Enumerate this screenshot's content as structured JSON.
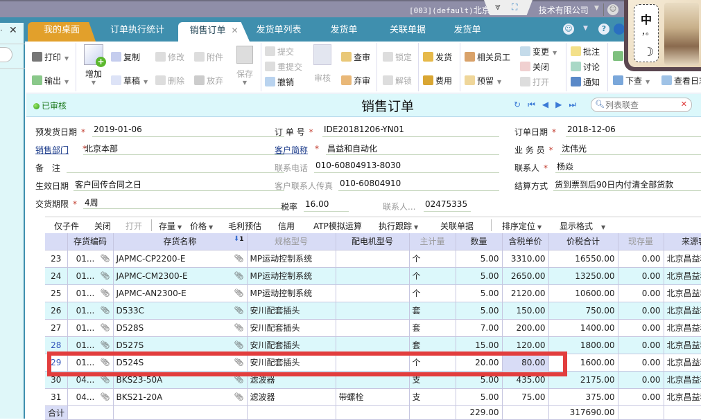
{
  "topbar": {
    "company_prefix": "[003](default)",
    "company_name": "北京昌益和自动化技术有限公司",
    "company_visible_left": "北京",
    "company_visible_right": "技术有限公司"
  },
  "tabs": [
    {
      "label": "我的桌面",
      "state": "home"
    },
    {
      "label": "订单执行统计",
      "state": "normal"
    },
    {
      "label": "销售订单",
      "state": "active",
      "closable": true
    },
    {
      "label": "发货单列表",
      "state": "normal"
    },
    {
      "label": "发货单",
      "state": "normal"
    },
    {
      "label": "关联单据",
      "state": "normal"
    },
    {
      "label": "发货单",
      "state": "normal"
    }
  ],
  "toolbar": {
    "print": "打印",
    "export": "输出",
    "add": "增加",
    "copy": "复制",
    "draft": "草稿",
    "modify": "修改",
    "delete": "删除",
    "attach": "附件",
    "discard": "放弃",
    "save": "保存",
    "submit": "提交",
    "resubmit": "重提交",
    "revoke": "撤销",
    "audit": "审核",
    "check_audit": "查审",
    "abandon_audit": "弃审",
    "lock": "锁定",
    "unlock": "解锁",
    "ship": "发货",
    "fee": "费用",
    "related_staff": "相关员工",
    "reserve": "预留",
    "change": "变更",
    "close": "关闭",
    "open": "打开",
    "annotate": "批注",
    "discuss": "讨论",
    "notify": "通知",
    "query_down": "下查",
    "view_log": "查看日志"
  },
  "ime": {
    "mode": "中",
    "punct": "，。",
    "moon": "☽"
  },
  "status": {
    "state_label": "已审核",
    "title": "销售订单",
    "search_placeholder": "列表联查"
  },
  "form": {
    "pre_ship_date_label": "预发货日期",
    "pre_ship_date": "2019-01-06",
    "order_no_label": "订 单 号",
    "order_no": "IDE20181206-YN01",
    "order_date_label": "订单日期",
    "order_date": "2018-12-06",
    "sales_dept_label": "销售部门",
    "sales_dept": "北京本部",
    "customer_label": "客户简称",
    "customer": "昌益和自动化",
    "salesman_label": "业 务 员",
    "salesman": "沈伟光",
    "remark_label": "备    注",
    "remark": "",
    "phone_label": "联系电话",
    "phone": "010-60804913-8030",
    "contact_label": "联系人",
    "contact": "杨焱",
    "effective_label": "生效日期",
    "effective": "客户回传合同之日",
    "fax_label": "客户联系人传真",
    "fax": "010-60804910",
    "settlement_label": "结算方式",
    "settlement": "货到票到后90日内付清全部货款",
    "delivery_label": "交货期限",
    "delivery": "4周",
    "tax_label": "税率",
    "tax": "16.00",
    "contact_tel_label": "联系人...",
    "contact_tel": "02475335"
  },
  "grid_toolbar": {
    "sub_only": "仅子件",
    "close": "关闭",
    "open": "打开",
    "stock": "存量",
    "price": "价格",
    "margin": "毛利预估",
    "credit": "信用",
    "atp": "ATP模拟运算",
    "track": "执行跟踪",
    "related": "关联单据",
    "sort": "排序定位",
    "format": "显示格式"
  },
  "grid": {
    "columns": [
      "",
      "存货编码",
      "存货名称",
      "规格型号",
      "配电机型号",
      "主计量",
      "数量",
      "含税单价",
      "价税合计",
      "现存量",
      "来源客"
    ],
    "rows": [
      {
        "no": "23",
        "code": "01...",
        "name": "JAPMC-CP2200-E",
        "spec": "MP运动控制系统",
        "motor": "",
        "unit": "个",
        "qty": "5.00",
        "price": "3310.00",
        "total": "16550.00",
        "stock": "0.00",
        "source": "北京昌益和"
      },
      {
        "no": "24",
        "code": "01...",
        "name": "JAPMC-CM2300-E",
        "spec": "MP运动控制系统",
        "motor": "",
        "unit": "个",
        "qty": "5.00",
        "price": "2650.00",
        "total": "13250.00",
        "stock": "0.00",
        "source": "北京昌益和"
      },
      {
        "no": "25",
        "code": "01...",
        "name": "JAPMC-AN2300-E",
        "spec": "MP运动控制系统",
        "motor": "",
        "unit": "个",
        "qty": "5.00",
        "price": "2120.00",
        "total": "10600.00",
        "stock": "0.00",
        "source": "北京昌益和"
      },
      {
        "no": "26",
        "code": "01...",
        "name": "D533C",
        "spec": "安川配套插头",
        "motor": "",
        "unit": "套",
        "qty": "5.00",
        "price": "150.00",
        "total": "750.00",
        "stock": "0.00",
        "source": "北京昌益和"
      },
      {
        "no": "27",
        "code": "01...",
        "name": "D528S",
        "spec": "安川配套插头",
        "motor": "",
        "unit": "套",
        "qty": "7.00",
        "price": "200.00",
        "total": "1400.00",
        "stock": "0.00",
        "source": "北京昌益和"
      },
      {
        "no": "28",
        "code": "01...",
        "name": "D527S",
        "spec": "安川配套插头",
        "motor": "",
        "unit": "套",
        "qty": "15.00",
        "price": "120.00",
        "total": "1800.00",
        "stock": "0.00",
        "source": "北京昌益和"
      },
      {
        "no": "29",
        "code": "01...",
        "name": "D524S",
        "spec": "安川配套插头",
        "motor": "",
        "unit": "个",
        "qty": "20.00",
        "price": "80.00",
        "total": "1600.00",
        "stock": "0.00",
        "source": "北京昌益和"
      },
      {
        "no": "30",
        "code": "04...",
        "name": "BKS23-50A",
        "spec": "滤波器",
        "motor": "",
        "unit": "支",
        "qty": "5.00",
        "price": "435.00",
        "total": "2175.00",
        "stock": "0.00",
        "source": "北京昌益和"
      },
      {
        "no": "31",
        "code": "04...",
        "name": "BKS21-20A",
        "spec": "滤波器",
        "motor": "带螺栓",
        "unit": "支",
        "qty": "5.00",
        "price": "75.00",
        "total": "375.00",
        "stock": "0.00",
        "source": "北京昌益和"
      }
    ],
    "total_label": "合计",
    "total_qty": "229.00",
    "total_amount": "317690.00",
    "selected_row": "29",
    "sort_indicator": "1"
  }
}
